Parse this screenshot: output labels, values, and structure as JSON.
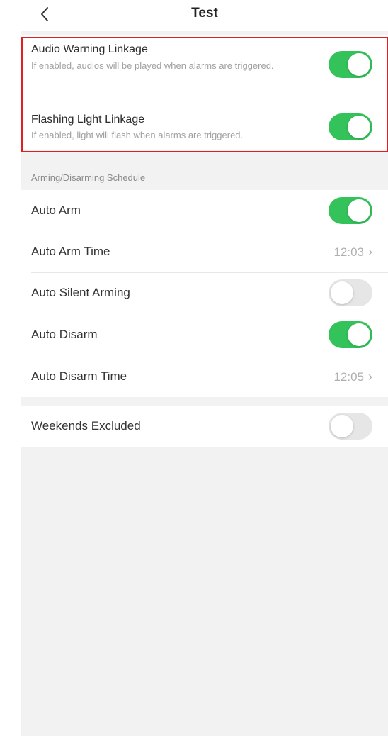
{
  "header": {
    "title": "Test"
  },
  "linkage": {
    "audio": {
      "title": "Audio Warning Linkage",
      "description": "If enabled, audios will be played when alarms are triggered.",
      "enabled": true
    },
    "light": {
      "title": "Flashing Light Linkage",
      "description": "If enabled, light will flash when alarms are triggered.",
      "enabled": true
    }
  },
  "schedule": {
    "section_title": "Arming/Disarming Schedule",
    "auto_arm": {
      "label": "Auto Arm",
      "enabled": true
    },
    "auto_arm_time": {
      "label": "Auto Arm Time",
      "value": "12:03"
    },
    "auto_silent_arming": {
      "label": "Auto Silent Arming",
      "enabled": false
    },
    "auto_disarm": {
      "label": "Auto Disarm",
      "enabled": true
    },
    "auto_disarm_time": {
      "label": "Auto Disarm Time",
      "value": "12:05"
    }
  },
  "weekends": {
    "label": "Weekends Excluded",
    "enabled": false
  },
  "colors": {
    "toggle_on": "#34c25a",
    "toggle_off": "#e6e6e6",
    "highlight": "#e02020"
  },
  "icons": {
    "back": "chevron-left-icon",
    "disclosure": "chevron-right-icon"
  }
}
